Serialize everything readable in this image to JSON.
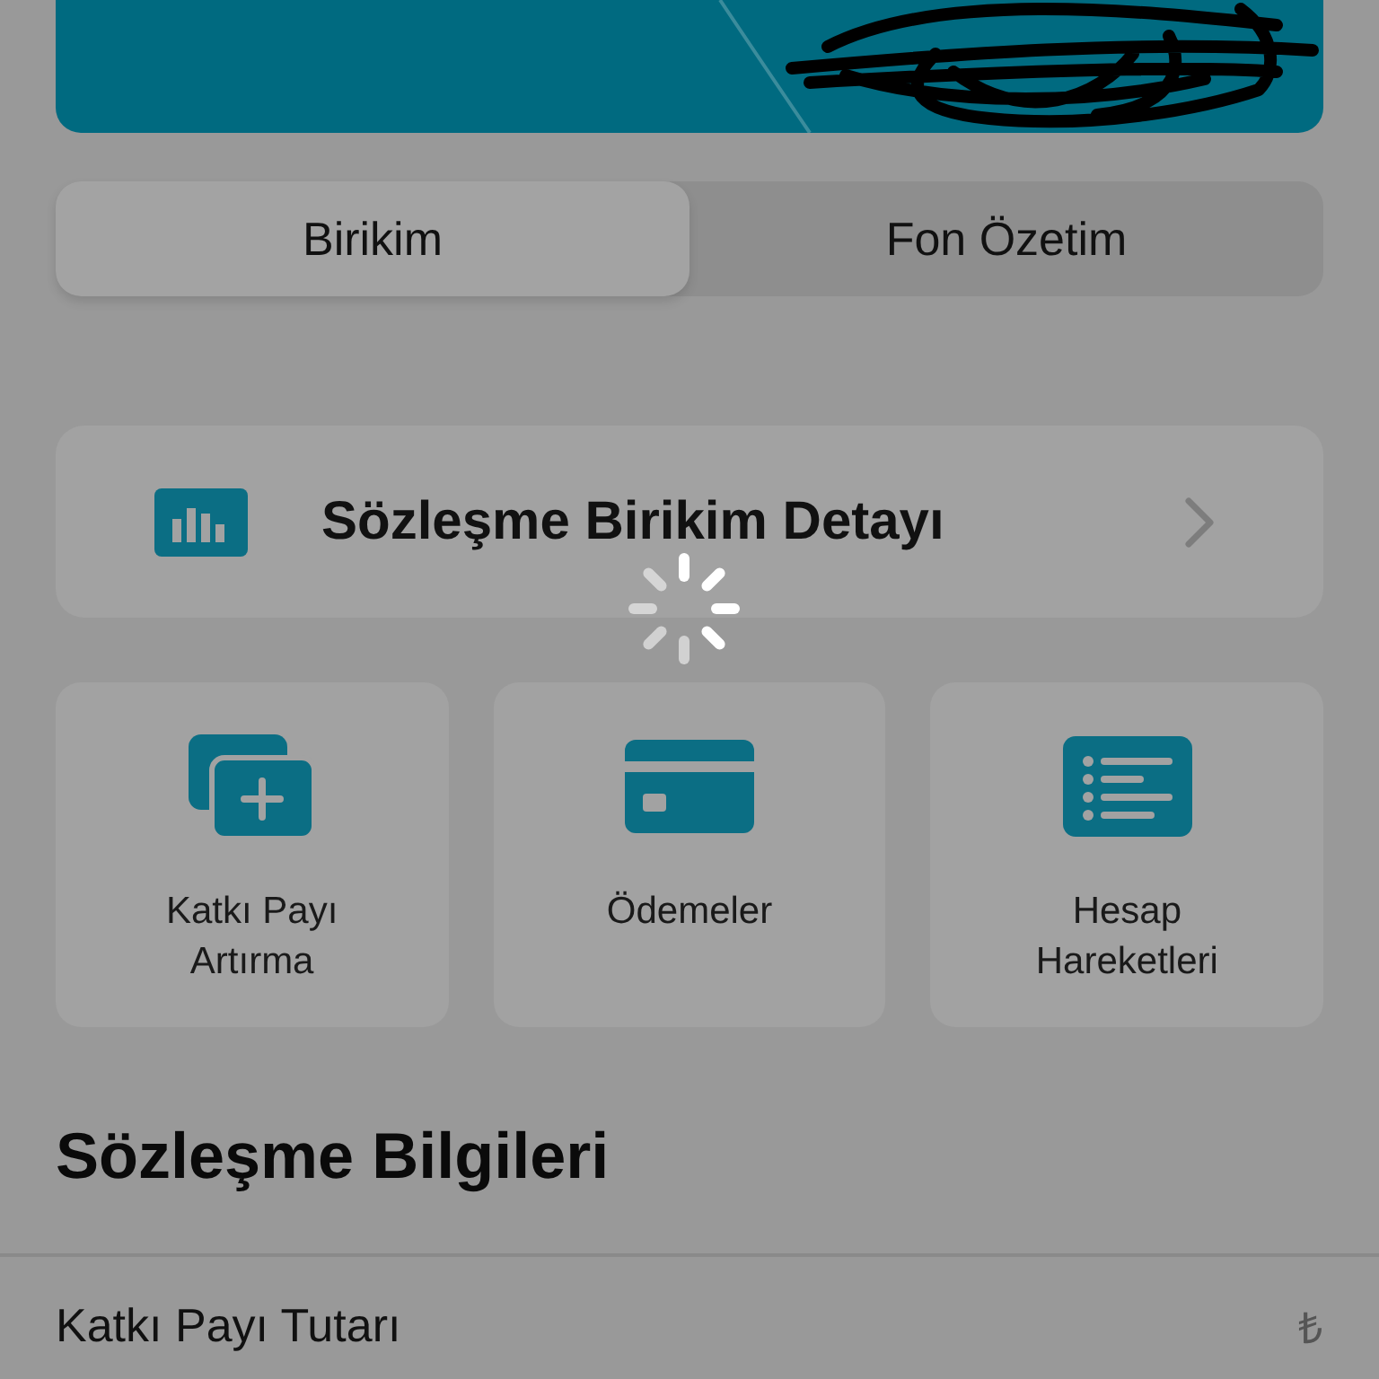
{
  "segments": [
    {
      "label": "Birikim",
      "selected": true
    },
    {
      "label": "Fon Özetim",
      "selected": false
    }
  ],
  "detail_row": {
    "title": "Sözleşme Birikim Detayı"
  },
  "loading": true,
  "tiles": [
    {
      "kind": "add",
      "label": "Katkı Payı\nArtırma"
    },
    {
      "kind": "card",
      "label": "Ödemeler"
    },
    {
      "kind": "list",
      "label": "Hesap\nHareketleri"
    }
  ],
  "section": {
    "title": "Sözleşme Bilgileri"
  },
  "info_rows": [
    {
      "label": "Katkı Payı Tutarı",
      "value": "₺"
    }
  ]
}
